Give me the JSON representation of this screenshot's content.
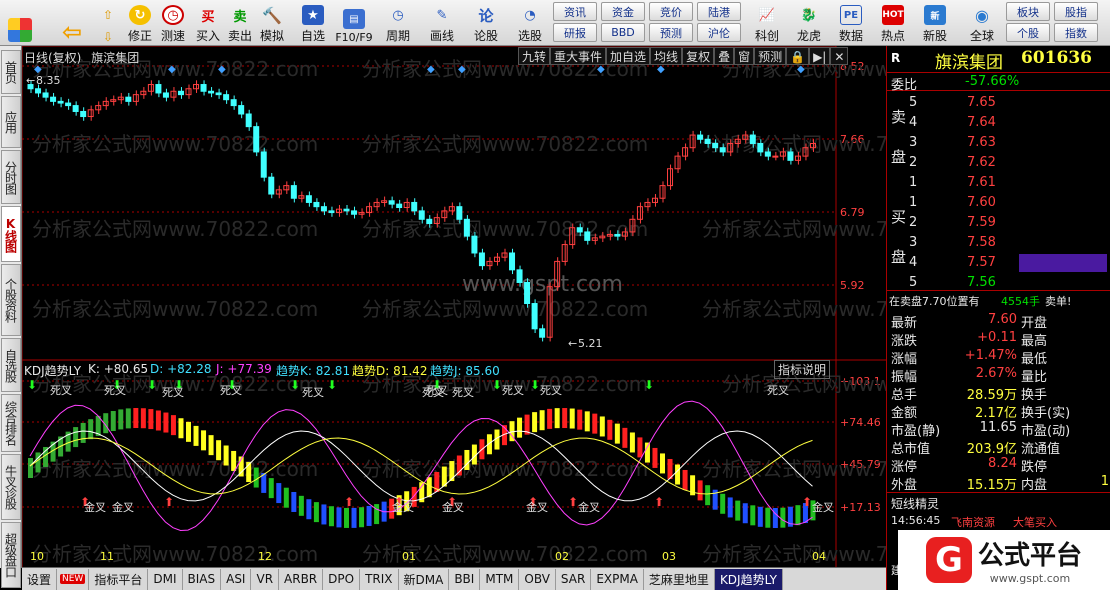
{
  "toolbar": {
    "buttons": [
      {
        "label": "",
        "icon": "grid-icon"
      },
      {
        "label": "",
        "icon": "back-arrow-icon"
      },
      {
        "label": "",
        "icon": "up-arrow-icon"
      },
      {
        "label": "修正",
        "icon": "refresh-icon"
      },
      {
        "label": "测速",
        "icon": "clock-icon"
      },
      {
        "label": "买入",
        "icon": "buy-icon"
      },
      {
        "label": "卖出",
        "icon": "sell-icon"
      },
      {
        "label": "模拟",
        "icon": "hammer-icon"
      },
      {
        "label": "自选",
        "icon": "star-icon"
      },
      {
        "label": "F10/F9",
        "icon": "f10-icon"
      },
      {
        "label": "周期",
        "icon": "period-icon"
      },
      {
        "label": "画线",
        "icon": "pen-icon"
      },
      {
        "label": "论股",
        "icon": "discuss-icon"
      },
      {
        "label": "选股",
        "icon": "pick-icon"
      }
    ],
    "small": [
      "资讯",
      "资金",
      "竞价",
      "陆港",
      "研报",
      "BBD",
      "预测",
      "沪伦"
    ],
    "right_buttons": [
      "科创",
      "龙虎",
      "数据",
      "热点",
      "新股",
      "全球"
    ],
    "far_right": [
      "板块",
      "股指",
      "个股",
      "指数"
    ]
  },
  "left_tabs": [
    "首页",
    "应用",
    "分时图",
    "K线图",
    "个股资料",
    "自选股",
    "综合排名",
    "牛叉诊股",
    "超级盘口"
  ],
  "chart": {
    "header_left": "日线(复权)",
    "stock_name": "旗滨集团",
    "header_buttons": [
      "九转",
      "重大事件",
      "加自选",
      "均线",
      "复权",
      "叠",
      "窗",
      "预测"
    ],
    "price_axis": [
      "8.52",
      "7.66",
      "6.79",
      "5.92"
    ],
    "high_label": "8.35",
    "low_label": "5.21",
    "watermark": "分析家公式网www.70822.com",
    "center_watermark": "www.gspt.com",
    "kdj_title": "KDJ趋势LY",
    "kdj_values": [
      "K: +80.65",
      "D: +82.28",
      "J: +77.39",
      "趋势K: 82.81",
      "趋势D: 81.42",
      "趋势J: 85.60"
    ],
    "kdj_help": "指标说明",
    "kdj_axis": [
      "+103.1",
      "+74.46",
      "+45.79",
      "+17.13"
    ],
    "cross_dead": "死叉",
    "cross_gold": "金叉",
    "months": [
      "10",
      "11",
      "12",
      "01",
      "02",
      "03",
      "04"
    ]
  },
  "bottom_tabs": [
    "设置",
    "NEW",
    "指标平台",
    "DMI",
    "BIAS",
    "ASI",
    "VR",
    "ARBR",
    "DPO",
    "TRIX",
    "新DMA",
    "BBI",
    "MTM",
    "OBV",
    "SAR",
    "EXPMA",
    "芝麻里地里",
    "KDJ趋势LY"
  ],
  "quote": {
    "r": "R",
    "name": "旗滨集团",
    "code": "601636",
    "weibi_label": "委比",
    "weibi": "-57.66%",
    "sell_label": [
      "卖",
      "盘"
    ],
    "buy_label": [
      "买",
      "盘"
    ],
    "sell": [
      [
        "5",
        "7.65"
      ],
      [
        "4",
        "7.64"
      ],
      [
        "3",
        "7.63"
      ],
      [
        "2",
        "7.62"
      ],
      [
        "1",
        "7.61"
      ]
    ],
    "buy": [
      [
        "1",
        "7.60"
      ],
      [
        "2",
        "7.59"
      ],
      [
        "3",
        "7.58"
      ],
      [
        "4",
        "7.57"
      ],
      [
        "5",
        "7.56"
      ]
    ],
    "status": "在卖盘7.70位置有",
    "status_vol": "4554手",
    "status_end": "卖单!",
    "stats_left": [
      [
        "最新",
        "7.60"
      ],
      [
        "涨跌",
        "+0.11"
      ],
      [
        "涨幅",
        "+1.47%"
      ],
      [
        "振幅",
        "2.67%"
      ],
      [
        "总手",
        "28.59万"
      ],
      [
        "金额",
        "2.17亿"
      ],
      [
        "市盈(静)",
        "11.65"
      ],
      [
        "总市值",
        "203.9亿"
      ],
      [
        "涨停",
        "8.24"
      ],
      [
        "外盘",
        "15.15万"
      ]
    ],
    "stats_right": [
      "开盘",
      "最高",
      "最低",
      "量比",
      "换手",
      "换手(实)",
      "市盈(动)",
      "流通值",
      "跌停",
      "内盘"
    ],
    "stats_right_vals": [
      "",
      "",
      "",
      "",
      "",
      "",
      "",
      "",
      "",
      "1"
    ],
    "short_title": "短线精灵",
    "short_time": "14:56:45",
    "short_stock": "飞南资源",
    "short_event": "大笔买入",
    "short_prefix": "建"
  },
  "logo": {
    "text": "公式平台",
    "url": "www.gspt.com"
  }
}
